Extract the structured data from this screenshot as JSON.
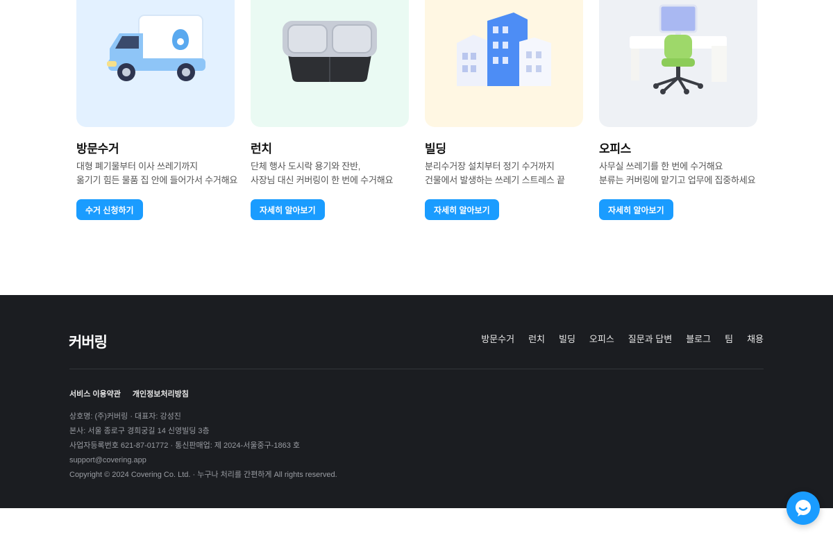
{
  "cards": [
    {
      "title": "방문수거",
      "desc_line1": "대형 폐기물부터 이사 쓰레기까지",
      "desc_line2": "옮기기 힘든 물품 집 안에 들어가서 수거해요",
      "button": "수거 신청하기",
      "icon": "truck-icon",
      "bg": "#e3f1ff"
    },
    {
      "title": "런치",
      "desc_line1": "단체 행사 도시락 용기와 잔반,",
      "desc_line2": "사장님 대신 커버링이 한 번에 수거해요",
      "button": "자세히 알아보기",
      "icon": "lunchbox-icon",
      "bg": "#eafaf3"
    },
    {
      "title": "빌딩",
      "desc_line1": "분리수거장 설치부터 정기 수거까지",
      "desc_line2": "건물에서 발생하는 쓰레기 스트레스 끝",
      "button": "자세히 알아보기",
      "icon": "building-icon",
      "bg": "#fff7e3"
    },
    {
      "title": "오피스",
      "desc_line1": "사무실 쓰레기를 한 번에 수거해요",
      "desc_line2": "분류는 커버링에 맡기고 업무에 집중하세요",
      "button": "자세히 알아보기",
      "icon": "office-desk-icon",
      "bg": "#eef1f5"
    }
  ],
  "footer": {
    "logo": "커버링",
    "nav": [
      "방문수거",
      "런치",
      "빌딩",
      "오피스",
      "질문과 답변",
      "블로그",
      "팀",
      "채용"
    ],
    "legal": [
      "서비스 이용약관",
      "개인정보처리방침"
    ],
    "info": [
      "상호명: (주)커버링 · 대표자: 강성진",
      "본사: 서울 종로구 경희궁길 14 신영빌딩 3층",
      "사업자등록번호 621-87-01772 · 통신판매업: 제 2024-서울중구-1863 호",
      "support@covering.app",
      "Copyright © 2024 Covering Co. Ltd. · 누구나 처리를 간편하게 All rights reserved."
    ]
  },
  "chat": {
    "icon": "chat-bubble-icon"
  },
  "colors": {
    "accent": "#1a9cff",
    "footer_bg": "#1b1d21"
  }
}
